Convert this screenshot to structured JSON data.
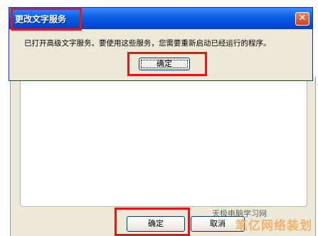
{
  "dialog": {
    "title": "更改文字服务",
    "close_symbol": "✕",
    "message": "已打开高级文字服务。要使用这些服务，您需要重新启动已经运行的程序。",
    "ok_label": "确定"
  },
  "background": {
    "ok_label": "确定",
    "cancel_label": "取消"
  },
  "watermark": {
    "text": "笔亿网络装划",
    "small_text": "天极电脑学习网"
  },
  "colors": {
    "highlight": "#e01818",
    "titlebar": "#0a5ee4",
    "dialog_bg": "#ece9d8"
  }
}
